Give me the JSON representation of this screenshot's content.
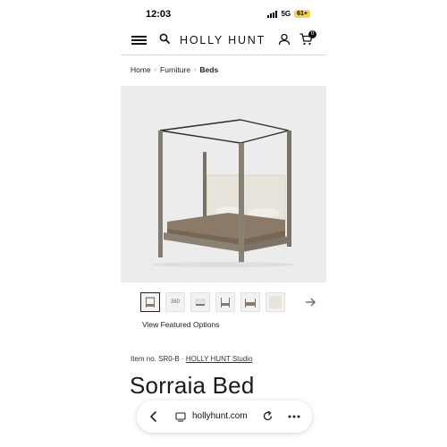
{
  "status_bar": {
    "time": "12:03",
    "network": "5G",
    "battery": "61+"
  },
  "header": {
    "brand": "HOLLY HUNT",
    "cart_count": "0"
  },
  "breadcrumb": {
    "items": [
      "Home",
      "Furniture",
      "Beds"
    ]
  },
  "gallery": {
    "thumb_360_label": "360",
    "featured_link": "View Featured Options"
  },
  "product": {
    "item_prefix": "Item no. SR0-B ·",
    "studio_link": "HOLLY HUNT Studio",
    "title": "Sorraia Bed"
  },
  "browser": {
    "url": "hollyhunt.com"
  },
  "colors": {
    "accent": "#111111",
    "battery": "#f3d54a",
    "hero_background": "#ececec"
  }
}
